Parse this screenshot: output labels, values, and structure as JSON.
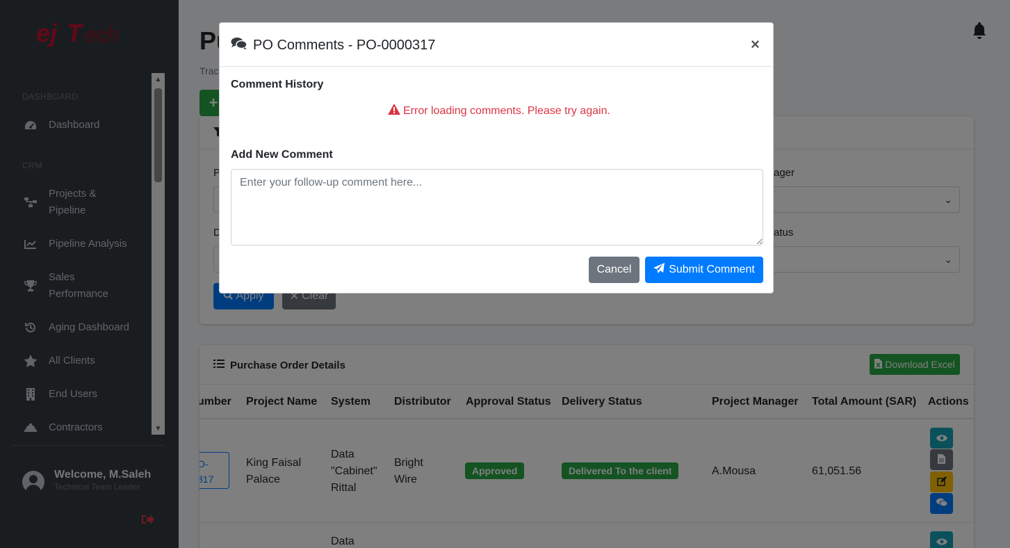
{
  "brand": {
    "logo_text": "EJTech",
    "accent": "#c8102e"
  },
  "sidebar": {
    "sections": [
      {
        "label": "DASHBOARD"
      },
      {
        "label": "CRM"
      }
    ],
    "items": [
      {
        "label": "Dashboard",
        "icon": "tachometer-icon"
      },
      {
        "label_line1": "Projects &",
        "label_line2": "Pipeline",
        "icon": "sitemap-icon"
      },
      {
        "label": "Pipeline Analysis",
        "icon": "chart-line-icon"
      },
      {
        "label_line1": "Sales",
        "label_line2": "Performance",
        "icon": "trophy-icon"
      },
      {
        "label": "Aging Dashboard",
        "icon": "history-icon"
      },
      {
        "label": "All Clients",
        "icon": "star-icon"
      },
      {
        "label": "End Users",
        "icon": "building-icon"
      },
      {
        "label": "Contractors",
        "icon": "hard-hat-icon"
      }
    ],
    "user": {
      "welcome": "Welcome, M.Saleh",
      "role": "Technical Team Leader"
    }
  },
  "page": {
    "title": "Pu",
    "subtitle": "Trac",
    "add_label": "+"
  },
  "filters": {
    "labels": [
      "P",
      "D",
      "ager",
      "atus"
    ],
    "apply_label": "Apply",
    "clear_label": "Clear"
  },
  "table": {
    "title": "Purchase Order Details",
    "download_label": "Download Excel",
    "columns": [
      "umber",
      "Project Name",
      "System",
      "Distributor",
      "Approval Status",
      "Delivery Status",
      "Project Manager",
      "Total Amount (SAR)",
      "Actions"
    ],
    "rows": [
      {
        "po_line1": "O-",
        "po_line2": "317",
        "project_line1": "King Faisal",
        "project_line2": "Palace",
        "system_line1": "Data",
        "system_line2": "\"Cabinet\"",
        "system_line3": "Rittal",
        "distributor_line1": "Bright",
        "distributor_line2": "Wire",
        "approval": "Approved",
        "delivery": "Delivered To the client",
        "manager": "A.Mousa",
        "amount": "61,051.56"
      },
      {
        "system_line1": "Data"
      }
    ],
    "status_color": "#28a745"
  },
  "modal": {
    "title": "PO Comments - PO-0000317",
    "history_label": "Comment History",
    "error_text": "Error loading comments. Please try again.",
    "new_label": "Add New Comment",
    "placeholder": "Enter your follow-up comment here...",
    "cancel_label": "Cancel",
    "submit_label": "Submit Comment"
  }
}
